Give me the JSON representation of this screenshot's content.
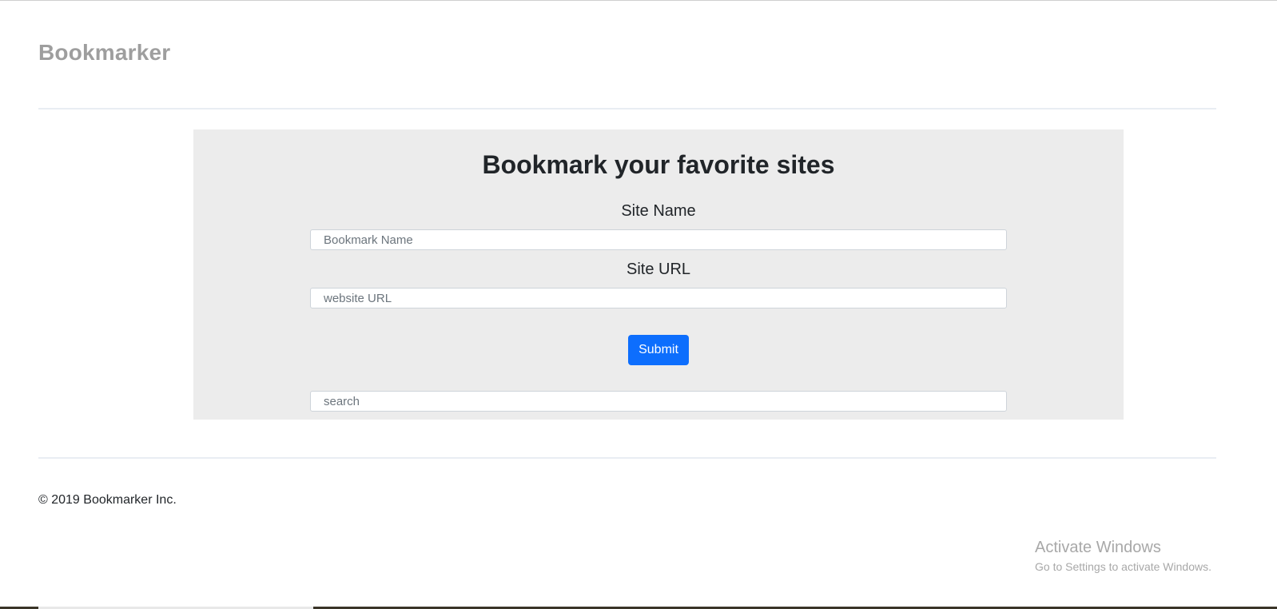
{
  "header": {
    "brand": "Bookmarker"
  },
  "form": {
    "heading": "Bookmark your favorite sites",
    "site_name_label": "Site Name",
    "site_name_placeholder": "Bookmark Name",
    "site_url_label": "Site URL",
    "site_url_placeholder": "website URL",
    "submit_label": "Submit",
    "search_placeholder": "search"
  },
  "footer": {
    "copyright": "© 2019 Bookmarker Inc."
  },
  "os_overlay": {
    "activate_title": "Activate Windows",
    "activate_subtitle": "Go to Settings to activate Windows."
  },
  "colors": {
    "brand_text": "#9e9e9e",
    "panel_bg": "#ececec",
    "primary_button": "#0d6efd"
  }
}
